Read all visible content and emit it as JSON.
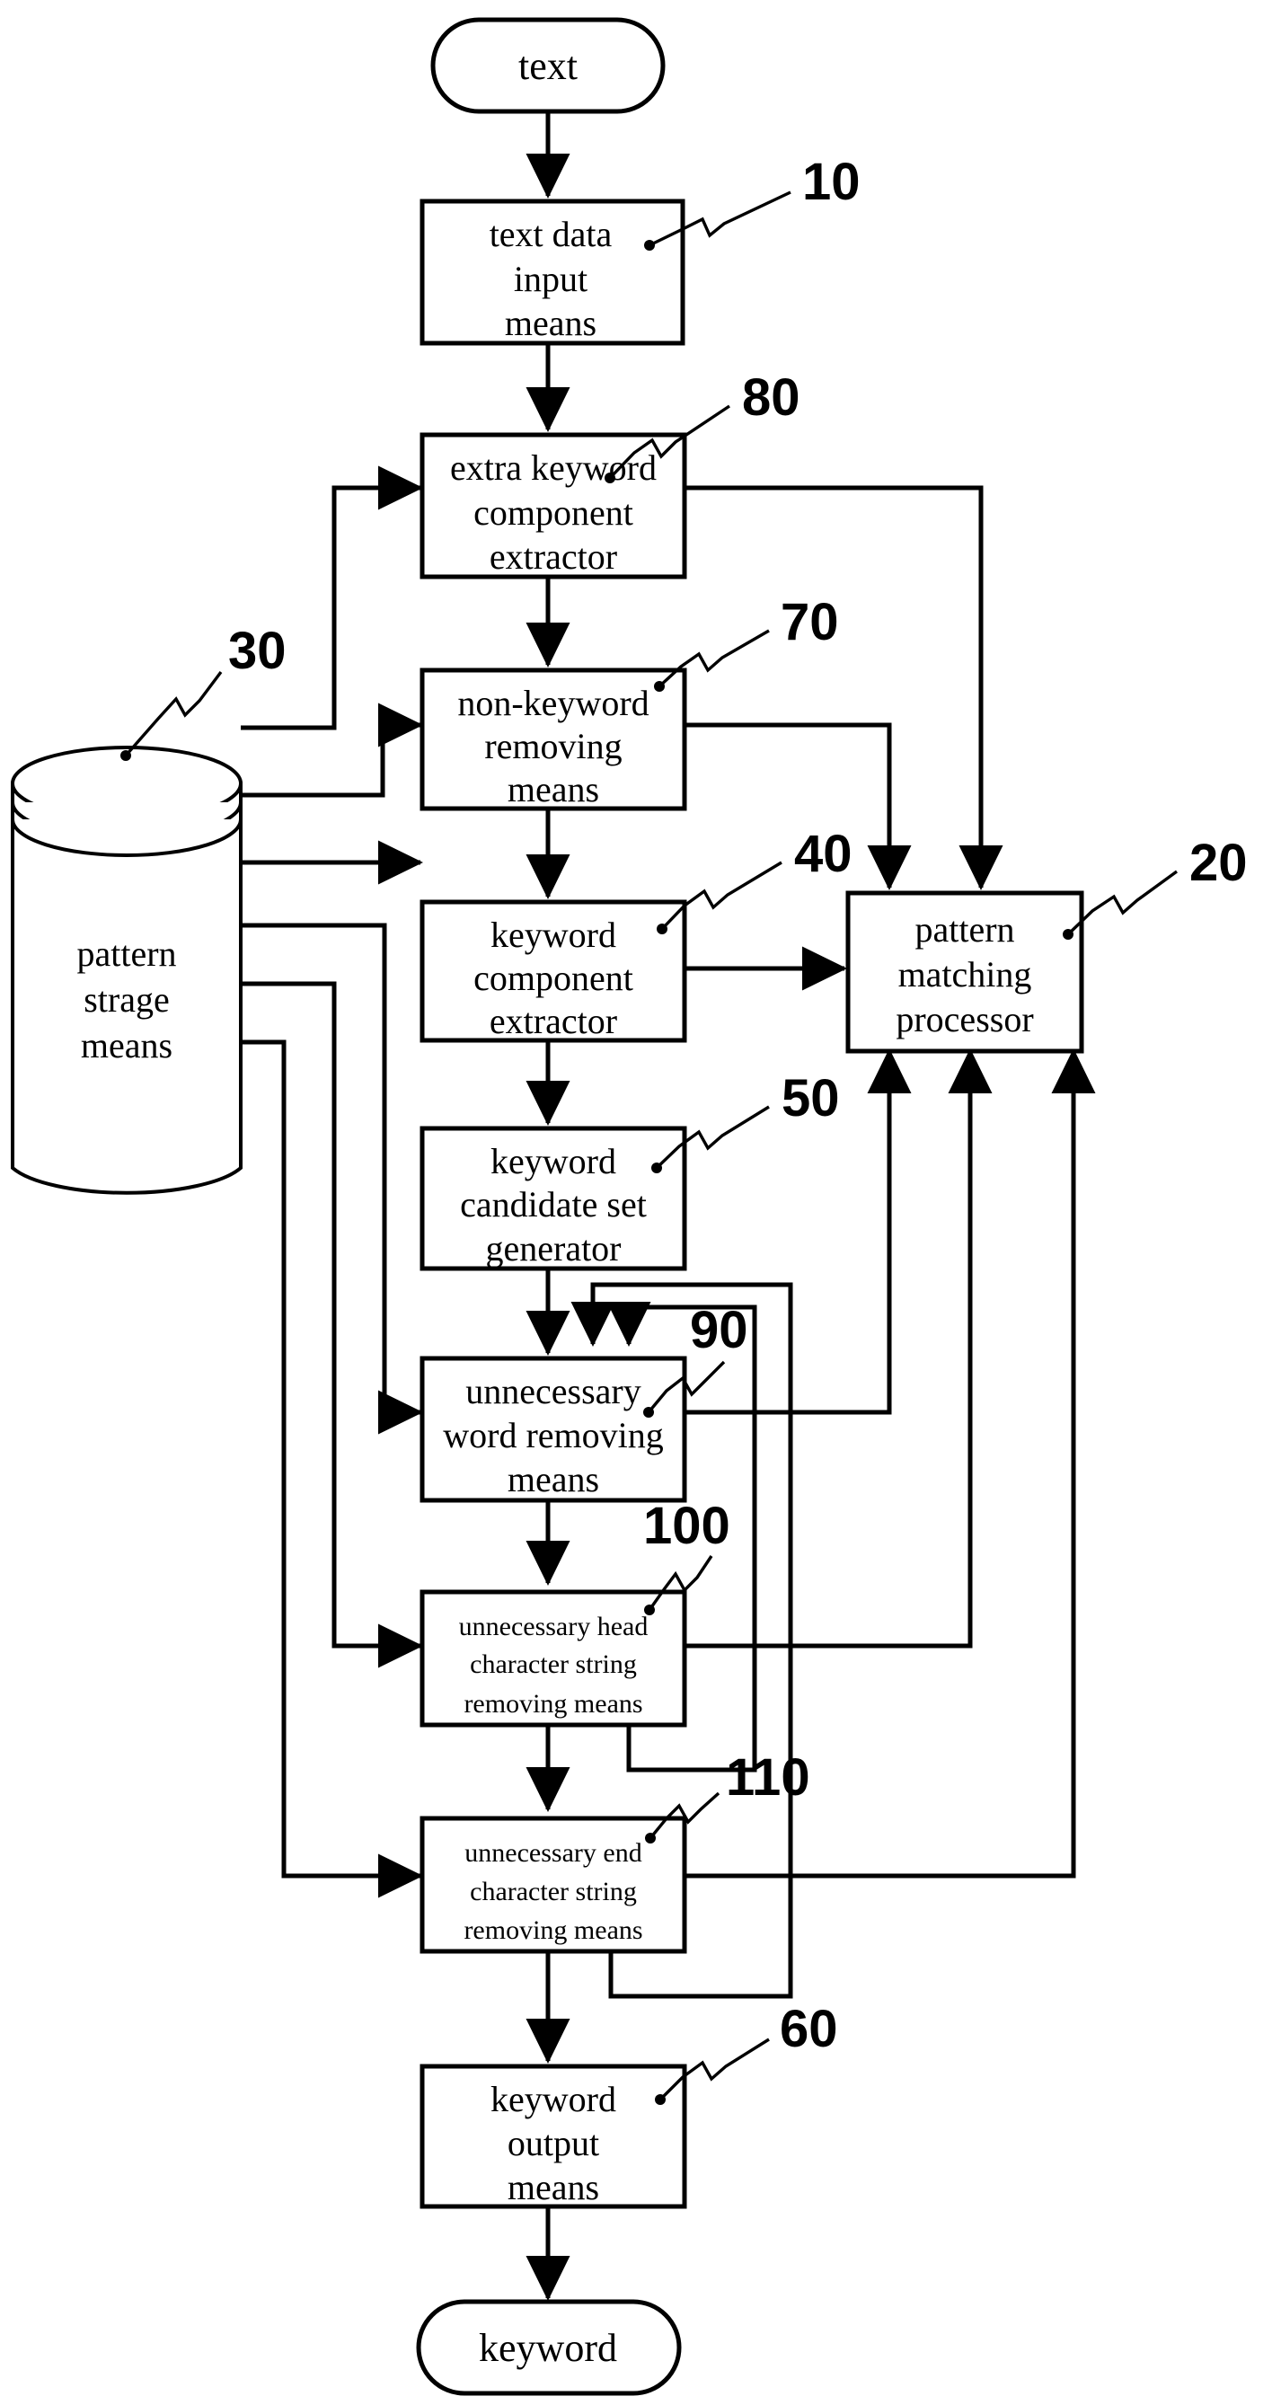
{
  "diagram": {
    "title": "keyword extraction apparatus block diagram",
    "stroke_color": "#000000",
    "background_color": "#ffffff",
    "terminals": [
      {
        "id": "start",
        "label": "text"
      },
      {
        "id": "end",
        "label": "keyword"
      }
    ],
    "blocks": [
      {
        "ref": "10",
        "label_lines": [
          "text data",
          "input",
          "means"
        ]
      },
      {
        "ref": "80",
        "label_lines": [
          "extra keyword",
          "component",
          "extractor"
        ]
      },
      {
        "ref": "70",
        "label_lines": [
          "non-keyword",
          "removing",
          "means"
        ]
      },
      {
        "ref": "40",
        "label_lines": [
          "keyword",
          "component",
          "extractor"
        ]
      },
      {
        "ref": "20",
        "label_lines": [
          "pattern",
          "matching",
          "processor"
        ]
      },
      {
        "ref": "50",
        "label_lines": [
          "keyword",
          "candidate set",
          "generator"
        ]
      },
      {
        "ref": "90",
        "label_lines": [
          "unnecessary",
          "word removing",
          "means"
        ]
      },
      {
        "ref": "100",
        "label_lines": [
          "unnecessary head",
          "character string",
          "removing means"
        ]
      },
      {
        "ref": "110",
        "label_lines": [
          "unnecessary end",
          "character string",
          "removing means"
        ]
      },
      {
        "ref": "60",
        "label_lines": [
          "keyword",
          "output",
          "means"
        ]
      }
    ],
    "storage": {
      "ref": "30",
      "label_lines": [
        "pattern",
        "strage",
        "means"
      ],
      "shape": "cylinder"
    },
    "ref_numbers": [
      "10",
      "80",
      "70",
      "30",
      "40",
      "20",
      "50",
      "90",
      "100",
      "110",
      "60"
    ]
  }
}
